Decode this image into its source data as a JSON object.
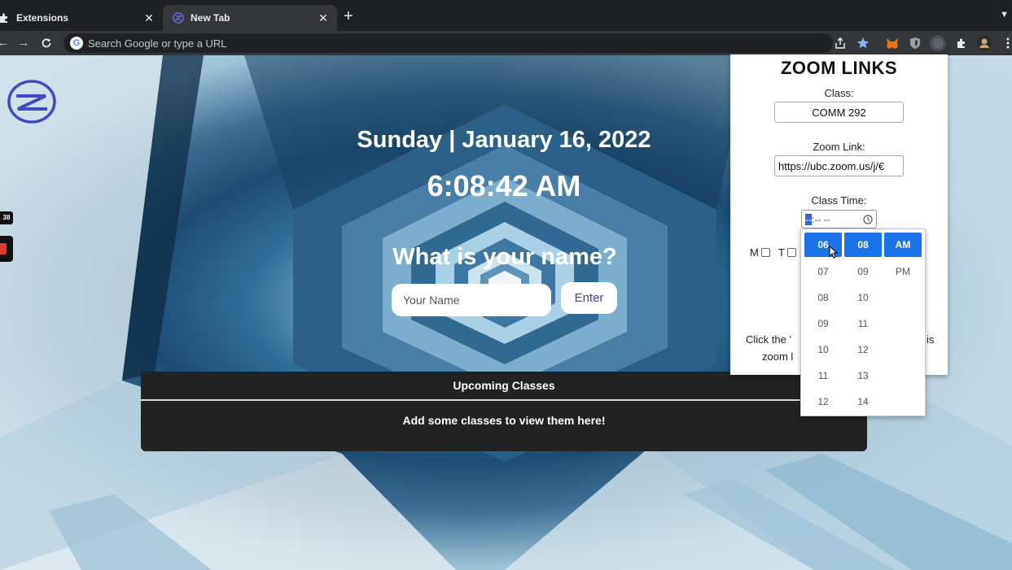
{
  "browser": {
    "tabs": [
      {
        "label": "Extensions",
        "active": false
      },
      {
        "label": "New Tab",
        "active": true
      }
    ],
    "omnibox": {
      "placeholder": "Search Google or type a URL"
    },
    "toolbar_icons": [
      "share-icon",
      "bookmark-star-icon",
      "metamask-icon",
      "shield-extension-icon",
      "profile-extension-icon",
      "puzzle-extensions-icon",
      "avatar-icon",
      "menu-dots-icon"
    ]
  },
  "page": {
    "date": "Sunday | January 16, 2022",
    "time": "6:08:42 AM",
    "question": "What is your name?",
    "name_placeholder": "Your Name",
    "enter_label": "Enter",
    "side_badge": "38",
    "upcoming": {
      "title": "Upcoming Classes",
      "empty_message": "Add some classes to view them here!"
    }
  },
  "popup": {
    "title": "ZOOM LINKS",
    "class_label": "Class:",
    "class_value": "COMM 292",
    "link_label": "Zoom Link:",
    "link_value": "https://ubc.zoom.us/j/€",
    "time_label": "Class Time:",
    "time_value_sel": "--",
    "time_value_rest": ":-- --",
    "days": [
      {
        "label": "M"
      },
      {
        "label": "T"
      }
    ],
    "note_line1": "Click the '",
    "note_line1_end": "is",
    "note_line2": "zoom l"
  },
  "picker": {
    "hours": [
      "06",
      "07",
      "08",
      "09",
      "10",
      "11",
      "12"
    ],
    "minutes": [
      "08",
      "09",
      "10",
      "11",
      "12",
      "13",
      "14"
    ],
    "ampm": [
      "AM",
      "PM"
    ],
    "selected": {
      "hour": "06",
      "minute": "08",
      "ampm": "AM"
    }
  },
  "colors": {
    "accent": "#1a73e8",
    "enter_text": "#4a3c8c",
    "panel_bg": "#232223"
  }
}
